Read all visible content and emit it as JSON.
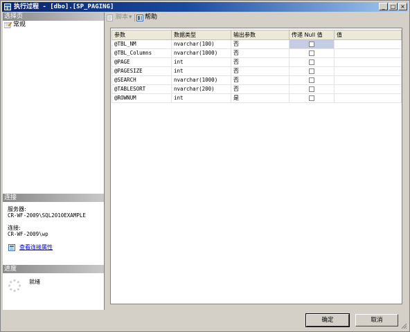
{
  "window": {
    "title": "执行过程 - [dbo].[SP_PAGING]",
    "controls": [
      "_",
      "□",
      "×"
    ]
  },
  "left": {
    "select_page_header": "选择页",
    "pages": [
      {
        "label": "常规"
      }
    ],
    "connection_header": "连接",
    "server_label": "服务器:",
    "server_value": "CR-WF-2009\\SQL2010EXAMPLE",
    "connection_label": "连接:",
    "connection_value": "CR-WF-2009\\wp",
    "view_props_link": "查看连接属性",
    "progress_header": "进度",
    "progress_status": "就绪"
  },
  "toolbar": {
    "script_label": "脚本",
    "help_label": "帮助"
  },
  "grid": {
    "columns": [
      "参数",
      "数据类型",
      "输出参数",
      "传递 Null 值",
      "值"
    ],
    "rows": [
      {
        "name": "@TBL_NM",
        "type": "nvarchar(100)",
        "output": "否",
        "null_checked": false,
        "value": ""
      },
      {
        "name": "@TBL_Columns",
        "type": "nvarchar(1000)",
        "output": "否",
        "null_checked": false,
        "value": ""
      },
      {
        "name": "@PAGE",
        "type": "int",
        "output": "否",
        "null_checked": false,
        "value": ""
      },
      {
        "name": "@PAGESIZE",
        "type": "int",
        "output": "否",
        "null_checked": false,
        "value": ""
      },
      {
        "name": "@SEARCH",
        "type": "nvarchar(1000)",
        "output": "否",
        "null_checked": false,
        "value": ""
      },
      {
        "name": "@TABLESORT",
        "type": "nvarchar(200)",
        "output": "否",
        "null_checked": false,
        "value": ""
      },
      {
        "name": "@ROWNUM",
        "type": "int",
        "output": "是",
        "null_checked": false,
        "value": ""
      }
    ]
  },
  "buttons": {
    "ok": "确定",
    "cancel": "取消"
  },
  "colors": {
    "titlebar_start": "#0a246a",
    "titlebar_end": "#a6caf0",
    "selected_cell": "#c4cde4",
    "link": "#0000cc"
  }
}
